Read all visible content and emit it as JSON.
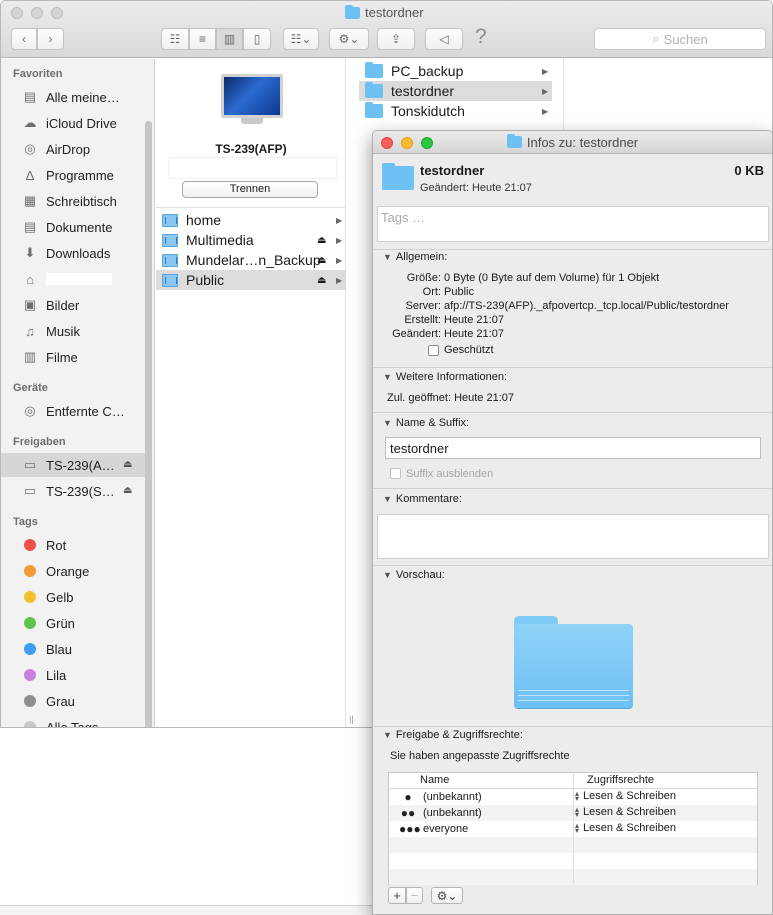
{
  "finder": {
    "title": "testordner",
    "search_placeholder": "Suchen",
    "help_glyph": "?",
    "sidebar": {
      "favorites_header": "Favoriten",
      "favorites": [
        {
          "label": "Alle meine…",
          "icon": "all-files-icon"
        },
        {
          "label": "iCloud Drive",
          "icon": "cloud-icon"
        },
        {
          "label": "AirDrop",
          "icon": "airdrop-icon"
        },
        {
          "label": "Programme",
          "icon": "applications-icon"
        },
        {
          "label": "Schreibtisch",
          "icon": "desktop-icon"
        },
        {
          "label": "Dokumente",
          "icon": "documents-icon"
        },
        {
          "label": "Downloads",
          "icon": "downloads-icon"
        },
        {
          "label": "",
          "icon": "home-icon"
        },
        {
          "label": "Bilder",
          "icon": "camera-icon"
        },
        {
          "label": "Musik",
          "icon": "music-icon"
        },
        {
          "label": "Filme",
          "icon": "film-icon"
        }
      ],
      "devices_header": "Geräte",
      "devices": [
        {
          "label": "Entfernte C…",
          "icon": "disc-icon"
        }
      ],
      "shared_header": "Freigaben",
      "shared": [
        {
          "label": "TS-239(A…",
          "icon": "server-icon",
          "selected": true
        },
        {
          "label": "TS-239(S…",
          "icon": "server-icon",
          "selected": false
        }
      ],
      "tags_header": "Tags",
      "tags": [
        {
          "label": "Rot",
          "color": "#f0504d"
        },
        {
          "label": "Orange",
          "color": "#f39b35"
        },
        {
          "label": "Gelb",
          "color": "#f2c12e"
        },
        {
          "label": "Grün",
          "color": "#5fc44b"
        },
        {
          "label": "Blau",
          "color": "#3f9cf0"
        },
        {
          "label": "Lila",
          "color": "#c882dd"
        },
        {
          "label": "Grau",
          "color": "#8e8e8e"
        },
        {
          "label": "Alle Tags…",
          "color": "#c8c8c8"
        }
      ]
    },
    "server": {
      "name": "TS-239(AFP)",
      "disconnect_label": "Trennen",
      "shares": [
        {
          "label": "home",
          "eject": false
        },
        {
          "label": "Multimedia",
          "eject": true
        },
        {
          "label": "Mundelar…n_Backup",
          "eject": true
        },
        {
          "label": "Public",
          "eject": true
        }
      ]
    },
    "column2": {
      "folders": [
        "PC_backup",
        "testordner",
        "Tonskidutch"
      ]
    }
  },
  "info": {
    "title": "Infos zu: testordner",
    "name": "testordner",
    "size": "0 KB",
    "modified": "Geändert: Heute 21:07",
    "tags_placeholder": "Tags …",
    "general": {
      "header": "Allgemein:",
      "size_key": "Größe:",
      "size_val": "0 Byte (0 Byte auf dem Volume) für 1 Objekt",
      "where_key": "Ort:",
      "where_val": "Public",
      "server_key": "Server:",
      "server_val": "afp://TS-239(AFP)._afpovertcp._tcp.local/Public/testordner",
      "created_key": "Erstellt:",
      "created_val": "Heute 21:07",
      "modified_key": "Geändert:",
      "modified_val": "Heute 21:07",
      "locked_label": "Geschützt"
    },
    "more": {
      "header": "Weitere Informationen:",
      "last_opened": "Zul. geöffnet: Heute 21:07"
    },
    "name_ext": {
      "header": "Name & Suffix:",
      "value": "testordner",
      "hide_ext_label": "Suffix ausblenden"
    },
    "comments": {
      "header": "Kommentare:"
    },
    "preview": {
      "header": "Vorschau:"
    },
    "sharing": {
      "header": "Freigabe & Zugriffsrechte:",
      "note": "Sie haben angepasste Zugriffsrechte",
      "col_name": "Name",
      "col_privilege": "Zugriffsrechte",
      "rows": [
        {
          "user": "(unbekannt)",
          "icon": "user-icon",
          "privilege": "Lesen & Schreiben"
        },
        {
          "user": "(unbekannt)",
          "icon": "group-icon",
          "privilege": "Lesen & Schreiben"
        },
        {
          "user": "everyone",
          "icon": "everyone-icon",
          "privilege": "Lesen & Schreiben"
        }
      ]
    }
  }
}
